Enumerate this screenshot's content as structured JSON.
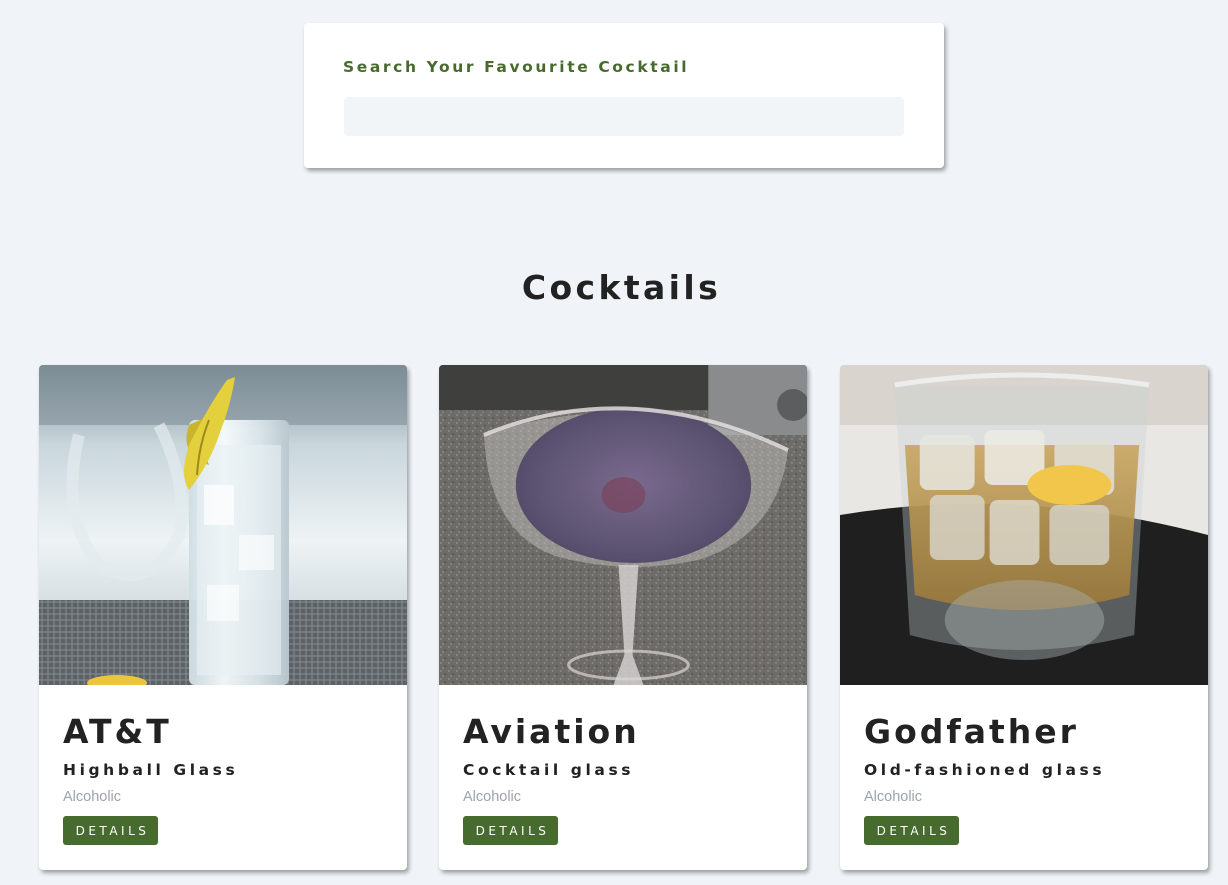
{
  "search": {
    "label": "Search Your Favourite Cocktail",
    "value": ""
  },
  "section_title": "Cocktails",
  "cocktails": [
    {
      "name": "AT&T",
      "glass": "Highball Glass",
      "type": "Alcoholic",
      "button_label": "DETAILS",
      "image_subject": "highball-glass-with-lemon-peel"
    },
    {
      "name": "Aviation",
      "glass": "Cocktail glass",
      "type": "Alcoholic",
      "button_label": "DETAILS",
      "image_subject": "purple-drink-in-cocktail-glass"
    },
    {
      "name": "Godfather",
      "glass": "Old-fashioned glass",
      "type": "Alcoholic",
      "button_label": "DETAILS",
      "image_subject": "whiskey-on-ice-in-rocks-glass"
    }
  ],
  "colors": {
    "accent": "#476a2e",
    "background": "#f0f4f8",
    "input_bg": "#f1f5f8",
    "text_dark": "#222222",
    "text_muted": "#9aa3ab"
  }
}
